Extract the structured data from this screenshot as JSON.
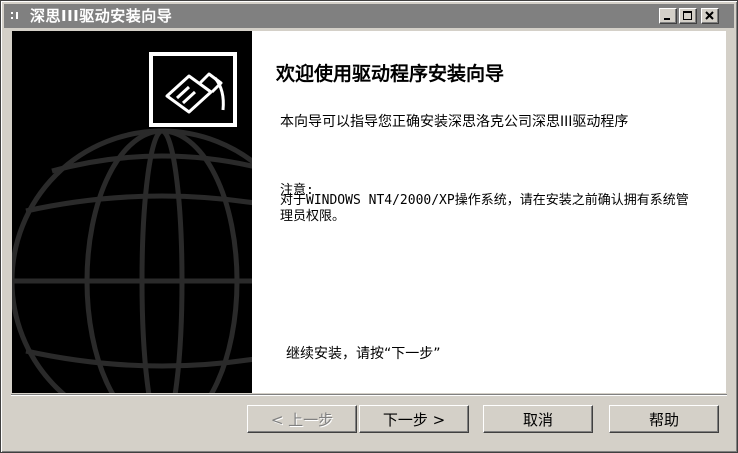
{
  "window": {
    "title": "深思III驱动安装向导",
    "controls": {
      "minimize_icon": "minimize-icon",
      "maximize_icon": "maximize-icon",
      "close_icon": "close-icon"
    }
  },
  "banner": {
    "logo_icon": "usb-plug-icon",
    "background_icon": "globe-icon"
  },
  "content": {
    "heading": "欢迎使用驱动程序安装向导",
    "description": "本向导可以指导您正确安装深思洛克公司深思III驱动程序",
    "note_label": "注意:",
    "note_text": "对于WINDOWS NT4/2000/XP操作系统，请在安装之前确认拥有系统管理员权限。",
    "continue_text": "继续安装，请按“下一步”"
  },
  "buttons": {
    "back": "< 上一步",
    "next": "下一步 >",
    "cancel": "取消",
    "help": "帮助"
  }
}
